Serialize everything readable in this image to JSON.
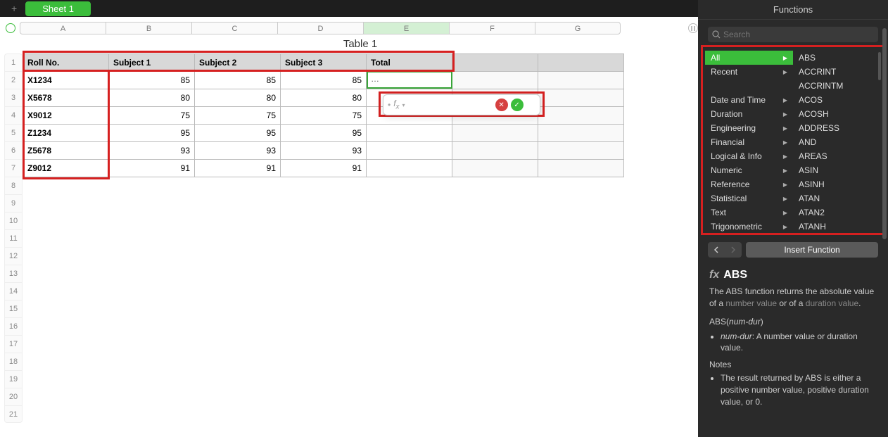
{
  "tabs": {
    "sheet": "Sheet 1"
  },
  "colheads": [
    "A",
    "B",
    "C",
    "D",
    "E",
    "F",
    "G"
  ],
  "rownums": [
    "1",
    "2",
    "3",
    "4",
    "5",
    "6",
    "7",
    "8",
    "9",
    "10",
    "11",
    "12",
    "13",
    "14",
    "15",
    "16",
    "17",
    "18",
    "19",
    "20",
    "21"
  ],
  "table": {
    "title": "Table 1",
    "headers": [
      "Roll No.",
      "Subject 1",
      "Subject 2",
      "Subject 3",
      "Total"
    ],
    "rows": [
      {
        "roll": "X1234",
        "s1": "85",
        "s2": "85",
        "s3": "85"
      },
      {
        "roll": "X5678",
        "s1": "80",
        "s2": "80",
        "s3": "80"
      },
      {
        "roll": "X9012",
        "s1": "75",
        "s2": "75",
        "s3": "75"
      },
      {
        "roll": "Z1234",
        "s1": "95",
        "s2": "95",
        "s3": "95"
      },
      {
        "roll": "Z5678",
        "s1": "93",
        "s2": "93",
        "s3": "93"
      },
      {
        "roll": "Z9012",
        "s1": "91",
        "s2": "91",
        "s3": "91"
      }
    ],
    "active_cell_text": "…"
  },
  "sidebar": {
    "title": "Functions",
    "search_placeholder": "Search",
    "categories": [
      "All",
      "Recent",
      "",
      "Date and Time",
      "Duration",
      "Engineering",
      "Financial",
      "Logical & Info",
      "Numeric",
      "Reference",
      "Statistical",
      "Text",
      "Trigonometric"
    ],
    "functions": [
      "ABS",
      "ACCRINT",
      "ACCRINTM",
      "ACOS",
      "ACOSH",
      "ADDRESS",
      "AND",
      "AREAS",
      "ASIN",
      "ASINH",
      "ATAN",
      "ATAN2",
      "ATANH"
    ],
    "insert_label": "Insert Function",
    "detail": {
      "name": "ABS",
      "desc1": "The ABS function returns the absolute value of a ",
      "desc_link1": "number value",
      "desc2": " or of a ",
      "desc_link2": "duration value",
      "desc3": ".",
      "sig_fn": "ABS",
      "sig_arg": "num-dur",
      "arg_name": "num-dur",
      "arg_desc": ": A number value or duration value.",
      "notes_h": "Notes",
      "note1": "The result returned by ABS is either a positive number value, positive duration value, or 0."
    }
  }
}
